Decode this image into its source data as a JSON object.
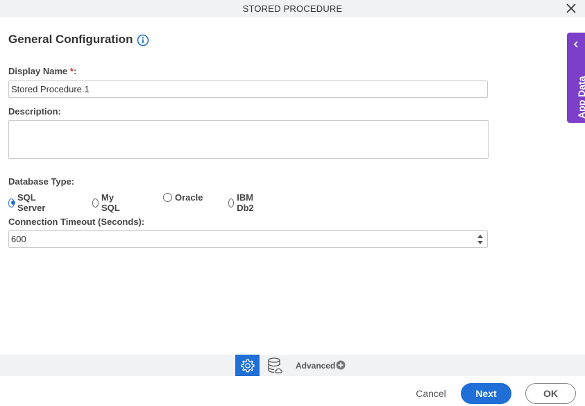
{
  "window": {
    "title": "STORED PROCEDURE",
    "close_icon": "close-icon"
  },
  "main": {
    "section_title": "General Configuration",
    "info_icon": "info-icon",
    "display_name": {
      "label": "Display Name",
      "required_mark": "*",
      "label_suffix": ":",
      "value": "Stored Procedure.1"
    },
    "description": {
      "label": "Description:",
      "value": ""
    },
    "database_type": {
      "label": "Database Type:",
      "options": [
        {
          "label": "SQL Server",
          "selected": true
        },
        {
          "label": "My SQL",
          "selected": false
        },
        {
          "label": "Oracle",
          "selected": false
        },
        {
          "label": "IBM Db2",
          "selected": false
        }
      ]
    },
    "connection_timeout": {
      "label": "Connection Timeout (Seconds):",
      "value": "600"
    }
  },
  "side_panel": {
    "label": "App Data",
    "icon": "chevron-left-icon",
    "color": "#7b3fc9"
  },
  "bottom_toolbar": {
    "settings_icon": "gear-icon",
    "data_icon": "database-icon",
    "advanced_label": "Advanced",
    "advanced_icon": "plus-circle-icon"
  },
  "footer": {
    "cancel_label": "Cancel",
    "next_label": "Next",
    "ok_label": "OK"
  },
  "colors": {
    "accent": "#1f6fd6",
    "required": "#d32f2f",
    "panel": "#f1f2f4"
  }
}
